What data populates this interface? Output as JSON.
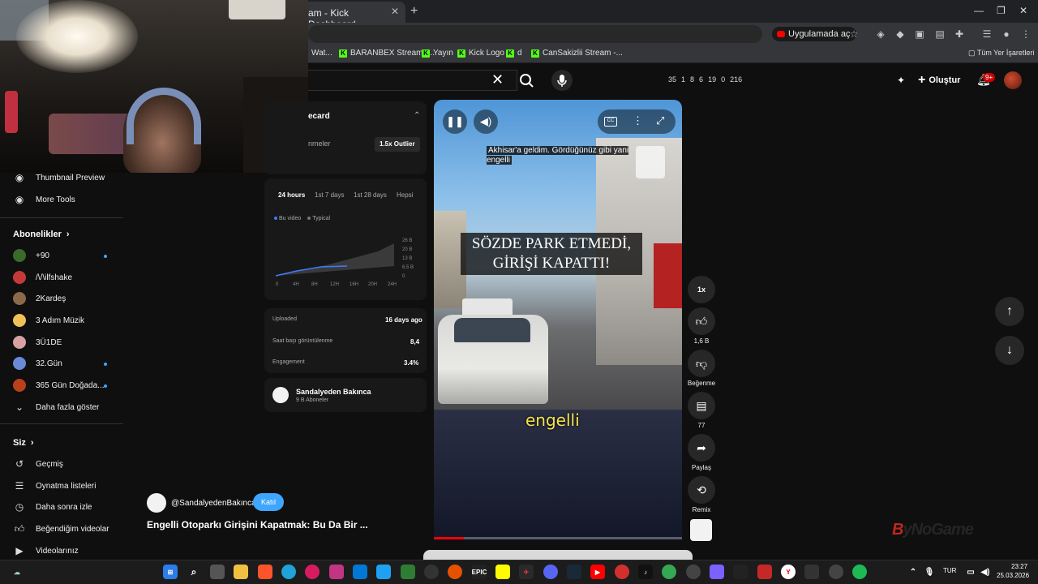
{
  "browser": {
    "tab_title": "am - Kick Dashboard",
    "open_in_app": "Uygulamada aç",
    "bookmarks": [
      {
        "label": "Wat..."
      },
      {
        "label": "BARANBEX Stream -..."
      },
      {
        "label": "Yayın"
      },
      {
        "label": "Kick Logo"
      },
      {
        "label": "d"
      },
      {
        "label": "CanSakizlii Stream -..."
      }
    ],
    "all_bookmarks": "Tüm Yer İşaretleri"
  },
  "header": {
    "stats": [
      "35",
      "1",
      "8",
      "6",
      "19",
      "0",
      "216"
    ],
    "create_label": "Oluştur",
    "notif_count": "9+"
  },
  "sidebar": {
    "tools": [
      {
        "label": "Thumbnail Preview"
      },
      {
        "label": "More Tools"
      }
    ],
    "subscriptions_heading": "Abonelikler",
    "channels": [
      {
        "label": "+90",
        "color": "#3a6b2a",
        "dot": true
      },
      {
        "label": "/\\/\\ilfshake",
        "color": "#c43a3a",
        "dot": false
      },
      {
        "label": "2Kardeş",
        "color": "#8a6a4a",
        "dot": false
      },
      {
        "label": "3 Adım Müzik",
        "color": "#f0c05a",
        "dot": false
      },
      {
        "label": "3Ü1DE",
        "color": "#d8a0a0",
        "dot": false
      },
      {
        "label": "32.Gün",
        "color": "#6a8ad8",
        "dot": true
      },
      {
        "label": "365 Gün Doğada...",
        "color": "#b8401a",
        "dot": true
      }
    ],
    "show_more": "Daha fazla göster",
    "you_heading": "Siz",
    "you_items": [
      {
        "label": "Geçmiş",
        "icon": "history-icon"
      },
      {
        "label": "Oynatma listeleri",
        "icon": "playlist-icon"
      },
      {
        "label": "Daha sonra izle",
        "icon": "clock-icon"
      },
      {
        "label": "Beğendiğim videolar",
        "icon": "like-icon"
      },
      {
        "label": "Videolarınız",
        "icon": "video-icon"
      }
    ]
  },
  "scorecard": {
    "title": "ecard",
    "subtitle": "nmeler",
    "outlier": "1.5x Outlier",
    "range_tabs": [
      "24 hours",
      "1st 7 days",
      "1st 28 days",
      "Hepsi"
    ],
    "legend": [
      "Bu video",
      "Typical"
    ],
    "y_ticks": [
      "26 B",
      "20 B",
      "13 B",
      "6,5 B",
      "0"
    ],
    "x_ticks": [
      "0",
      "4H",
      "8H",
      "12H",
      "16H",
      "20H",
      "24H"
    ],
    "metrics": [
      {
        "label": "Uploaded",
        "value": "16 days ago"
      },
      {
        "label": "Saat başı görüntülenme",
        "value": "8,4"
      },
      {
        "label": "Engagement",
        "value": "3.4%"
      }
    ],
    "channel_name": "Sandalyeden Bakınca",
    "channel_subs": "9 B Aboneler"
  },
  "video": {
    "caption_top": "Akhisar'a geldim. Gördüğünüz gibi yani engelli",
    "headline_1": "SÖZDE PARK ETMEDİ,",
    "headline_2": "GİRİŞİ KAPATTI!",
    "subtitle": "engelli",
    "progress": 0.12
  },
  "actions": {
    "speed": "1x",
    "likes": "1,6 B",
    "dislike": "Beğenme",
    "comments": "77",
    "share": "Paylaş",
    "remix": "Remix"
  },
  "below_video": {
    "channel_handle": "@SandalyedenBakınca",
    "join": "Katıl",
    "title": "Engelli Otoparkı Girişini Kapatmak: Bu Da Bir ..."
  },
  "watermark": "ByNoGame",
  "taskbar": {
    "lang": "TUR",
    "time": "23:27",
    "date": "25.03.2026"
  }
}
